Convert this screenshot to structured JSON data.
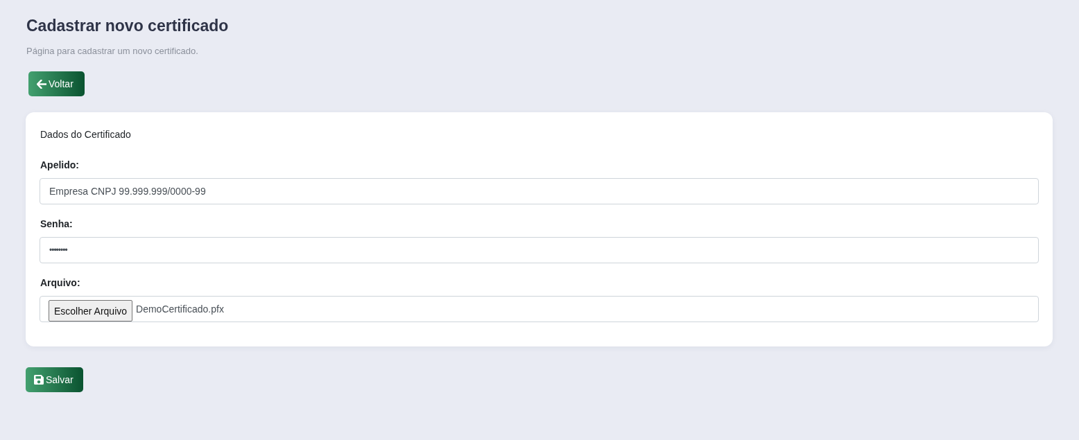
{
  "page": {
    "title": "Cadastrar novo certificado",
    "subtitle": "Página para cadastrar um novo certificado."
  },
  "back_button": {
    "label": "Voltar"
  },
  "card": {
    "title": "Dados do Certificado",
    "fields": [
      {
        "kind": "text",
        "label": "Apelido:",
        "value": "Empresa CNPJ 99.999.999/0000-99"
      },
      {
        "kind": "password",
        "label": "Senha:",
        "value": "••••••••"
      },
      {
        "kind": "file",
        "label": "Arquivo:",
        "button_label": "Escolher Arquivo",
        "value": "DemoCertificado.pfx"
      }
    ]
  },
  "save_button": {
    "label": "Salvar"
  }
}
